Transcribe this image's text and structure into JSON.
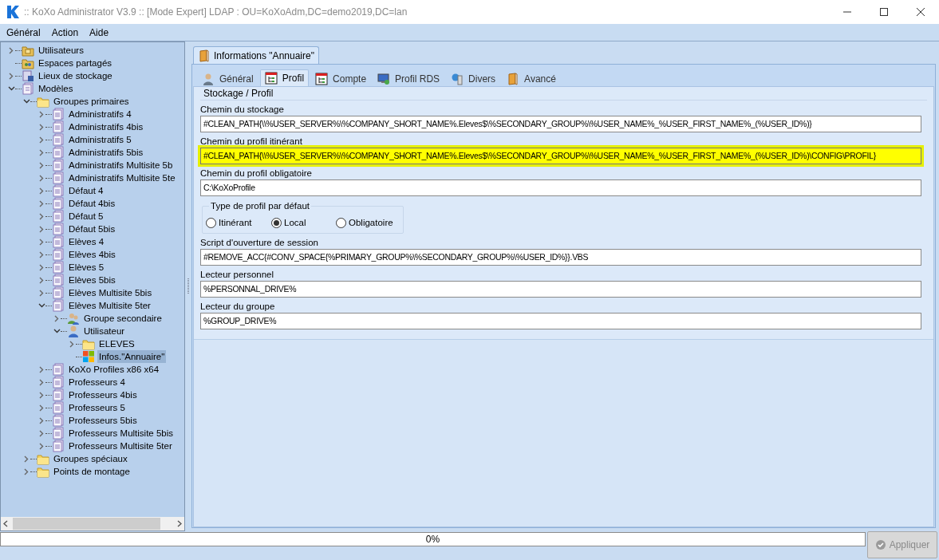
{
  "window": {
    "title": ":: KoXo Administrator V3.9 :: [Mode Expert] LDAP : OU=KoXoAdm,DC=demo2019,DC=lan"
  },
  "menu": [
    "Général",
    "Action",
    "Aide"
  ],
  "tree": [
    {
      "label": "Utilisateurs",
      "kind": "users-folder",
      "expanded": false,
      "selected": false
    },
    {
      "label": "Espaces partagés",
      "kind": "shared",
      "selected": false
    },
    {
      "label": "Lieux de stockage",
      "kind": "storage",
      "expanded": false,
      "selected": false
    },
    {
      "label": "Modèles",
      "kind": "models",
      "expanded": true,
      "selected": false,
      "children": [
        {
          "label": "Groupes primaires",
          "kind": "folder",
          "expanded": true,
          "selected": false,
          "children": [
            {
              "label": "Administratifs 4",
              "kind": "document",
              "expanded": false,
              "selected": false
            },
            {
              "label": "Administratifs 4bis",
              "kind": "document",
              "expanded": false,
              "selected": false
            },
            {
              "label": "Administratifs 5",
              "kind": "document",
              "expanded": false,
              "selected": false
            },
            {
              "label": "Administratifs 5bis",
              "kind": "document",
              "expanded": false,
              "selected": false
            },
            {
              "label": "Administratifs Multisite 5b",
              "kind": "document",
              "expanded": false,
              "selected": false
            },
            {
              "label": "Administratifs Multisite 5te",
              "kind": "document",
              "expanded": false,
              "selected": false
            },
            {
              "label": "Défaut 4",
              "kind": "document",
              "expanded": false,
              "selected": false
            },
            {
              "label": "Défaut 4bis",
              "kind": "document",
              "expanded": false,
              "selected": false
            },
            {
              "label": "Défaut 5",
              "kind": "document",
              "expanded": false,
              "selected": false
            },
            {
              "label": "Défaut 5bis",
              "kind": "document",
              "expanded": false,
              "selected": false
            },
            {
              "label": "Elèves 4",
              "kind": "document",
              "expanded": false,
              "selected": false
            },
            {
              "label": "Elèves 4bis",
              "kind": "document",
              "expanded": false,
              "selected": false
            },
            {
              "label": "Elèves 5",
              "kind": "document",
              "expanded": false,
              "selected": false
            },
            {
              "label": "Elèves 5bis",
              "kind": "document",
              "expanded": false,
              "selected": false
            },
            {
              "label": "Elèves Multisite 5bis",
              "kind": "document",
              "expanded": false,
              "selected": false
            },
            {
              "label": "Elèves Multisite 5ter",
              "kind": "document",
              "expanded": true,
              "selected": false,
              "children": [
                {
                  "label": "Groupe secondaire",
                  "kind": "group",
                  "expanded": false,
                  "selected": false
                },
                {
                  "label": "Utilisateur",
                  "kind": "user",
                  "expanded": true,
                  "selected": false,
                  "children": [
                    {
                      "label": "ELEVES",
                      "kind": "folder",
                      "expanded": false,
                      "selected": false
                    },
                    {
                      "label": "Infos.\"Annuaire\"",
                      "kind": "windows",
                      "selected": true
                    }
                  ]
                }
              ]
            },
            {
              "label": "KoXo Profiles x86 x64",
              "kind": "document",
              "expanded": false,
              "selected": false
            },
            {
              "label": "Professeurs 4",
              "kind": "document",
              "expanded": false,
              "selected": false
            },
            {
              "label": "Professeurs 4bis",
              "kind": "document",
              "expanded": false,
              "selected": false
            },
            {
              "label": "Professeurs 5",
              "kind": "document",
              "expanded": false,
              "selected": false
            },
            {
              "label": "Professeurs 5bis",
              "kind": "document",
              "expanded": false,
              "selected": false
            },
            {
              "label": "Professeurs Multisite 5bis",
              "kind": "document",
              "expanded": false,
              "selected": false
            },
            {
              "label": "Professeurs Multisite 5ter",
              "kind": "document",
              "expanded": false,
              "selected": false
            }
          ]
        },
        {
          "label": "Groupes spéciaux",
          "kind": "folder",
          "expanded": false,
          "selected": false
        },
        {
          "label": "Points de montage",
          "kind": "folder",
          "expanded": false,
          "selected": false
        }
      ]
    }
  ],
  "doc_tab": {
    "label": "Informations \"Annuaire\"",
    "selected": true
  },
  "tabs": [
    {
      "label": "Général",
      "kind": "person",
      "selected": false
    },
    {
      "label": "Profil",
      "kind": "chart",
      "selected": true
    },
    {
      "label": "Compte",
      "kind": "chart",
      "selected": false
    },
    {
      "label": "Profil RDS",
      "kind": "monitor",
      "selected": false
    },
    {
      "label": "Divers",
      "kind": "server",
      "selected": false
    },
    {
      "label": "Avancé",
      "kind": "book",
      "selected": false
    }
  ],
  "group_title": "Stockage / Profil",
  "form": [
    {
      "kind": "field",
      "label": "Chemin du stockage",
      "value": "#CLEAN_PATH{\\\\%USER_SERVER%\\%COMPANY_SHORT_NAME%.Eleves$\\%SECONDARY_GROUP%\\%USER_NAME%_%USER_FIRST_NAME%_(%USER_ID%)}",
      "highlighted": false
    },
    {
      "kind": "field",
      "label": "Chemin du profil itinérant",
      "value": "#CLEAN_PATH{\\\\%USER_SERVER%\\%COMPANY_SHORT_NAME%.Eleves$\\%SECONDARY_GROUP%\\%USER_NAME%_%USER_FIRST_NAME%_(%USER_ID%)\\CONFIG\\PROFIL}",
      "highlighted": true
    },
    {
      "kind": "field",
      "label": "Chemin du profil obligatoire",
      "value": "C:\\KoXoProfile",
      "highlighted": false
    },
    {
      "kind": "radio_group",
      "label": "Type de profil par défaut",
      "options": [
        {
          "label": "Itinérant",
          "selected": false
        },
        {
          "label": "Local",
          "selected": true
        },
        {
          "label": "Obligatoire",
          "selected": false
        }
      ]
    },
    {
      "kind": "field",
      "label": "Script d'ouverture de session",
      "value": "#REMOVE_ACC{#CONV_SPACE{%PRIMARY_GROUP%\\%SECONDARY_GROUP%\\%USER_ID%}}.VBS",
      "highlighted": false
    },
    {
      "kind": "field",
      "label": "Lecteur personnel",
      "value": "%PERSONNAL_DRIVE%",
      "highlighted": false
    },
    {
      "kind": "field",
      "label": "Lecteur du groupe",
      "value": "%GROUP_DRIVE%",
      "highlighted": false
    }
  ],
  "progress": {
    "level": 0,
    "text": "0%"
  },
  "apply_button": {
    "label": "Appliquer",
    "disabled": true
  }
}
